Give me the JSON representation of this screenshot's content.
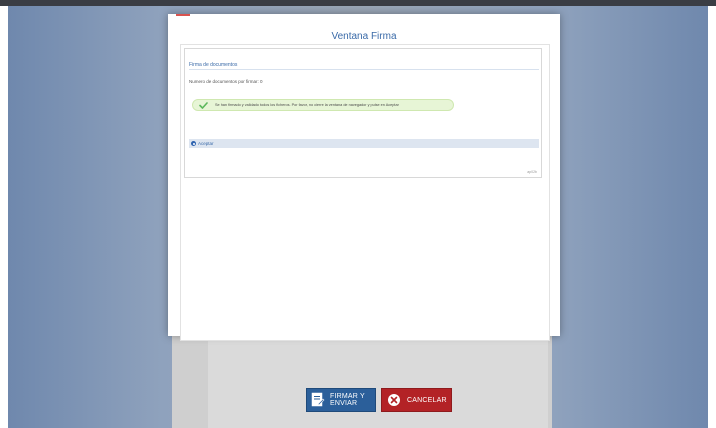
{
  "modal": {
    "title": "Ventana Firma",
    "panel_title": "Firma de documentos",
    "doc_count_text": "Numero de documentos por firmar: 0",
    "alert_message": "Se han firmado y validado todos los ficheros. Por favor, no cierre la ventana de navegador y pulse en Aceptar",
    "option_label": "Aceptar",
    "footer_tag": "ap02b"
  },
  "buttons": {
    "sign_label": "FIRMAR Y ENVIAR",
    "cancel_label": "CANCELAR"
  },
  "colors": {
    "accent_blue": "#3a6aa8",
    "success_bg": "#e7f5d6",
    "success_icon": "#5cb85c",
    "sign_button": "#2b5f9a",
    "cancel_button": "#b32226"
  },
  "icons": {
    "alert": "check-icon",
    "option": "radio-icon",
    "sign": "document-sign-icon",
    "cancel": "close-circle-icon"
  }
}
